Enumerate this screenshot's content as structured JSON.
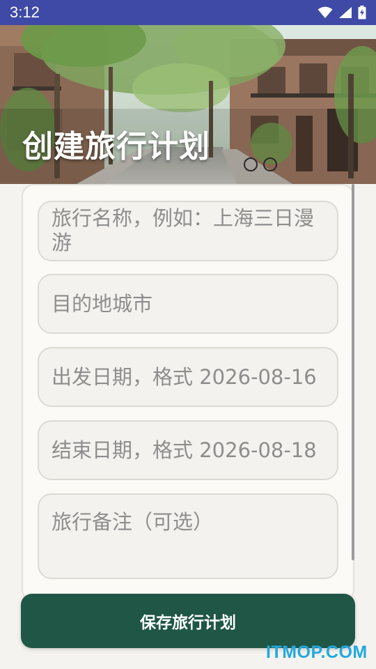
{
  "status_bar": {
    "time": "3:12",
    "icons": [
      "wifi-icon",
      "signal-icon",
      "battery-charging-icon"
    ]
  },
  "hero": {
    "title": "创建旅行计划"
  },
  "form": {
    "name_placeholder": "旅行名称，例如：上海三日漫游",
    "city_placeholder": "目的地城市",
    "start_date_placeholder": "出发日期，格式 2026-08-16",
    "end_date_placeholder": "结束日期，格式 2026-08-18",
    "notes_placeholder": "旅行备注（可选）"
  },
  "actions": {
    "save_label": "保存旅行计划"
  },
  "watermark": "ITMOP.COM",
  "colors": {
    "status_bar": "#3e4aa5",
    "button": "#1f5646",
    "placeholder_text": "#8d8d8d",
    "watermark": "#22a9e0"
  }
}
